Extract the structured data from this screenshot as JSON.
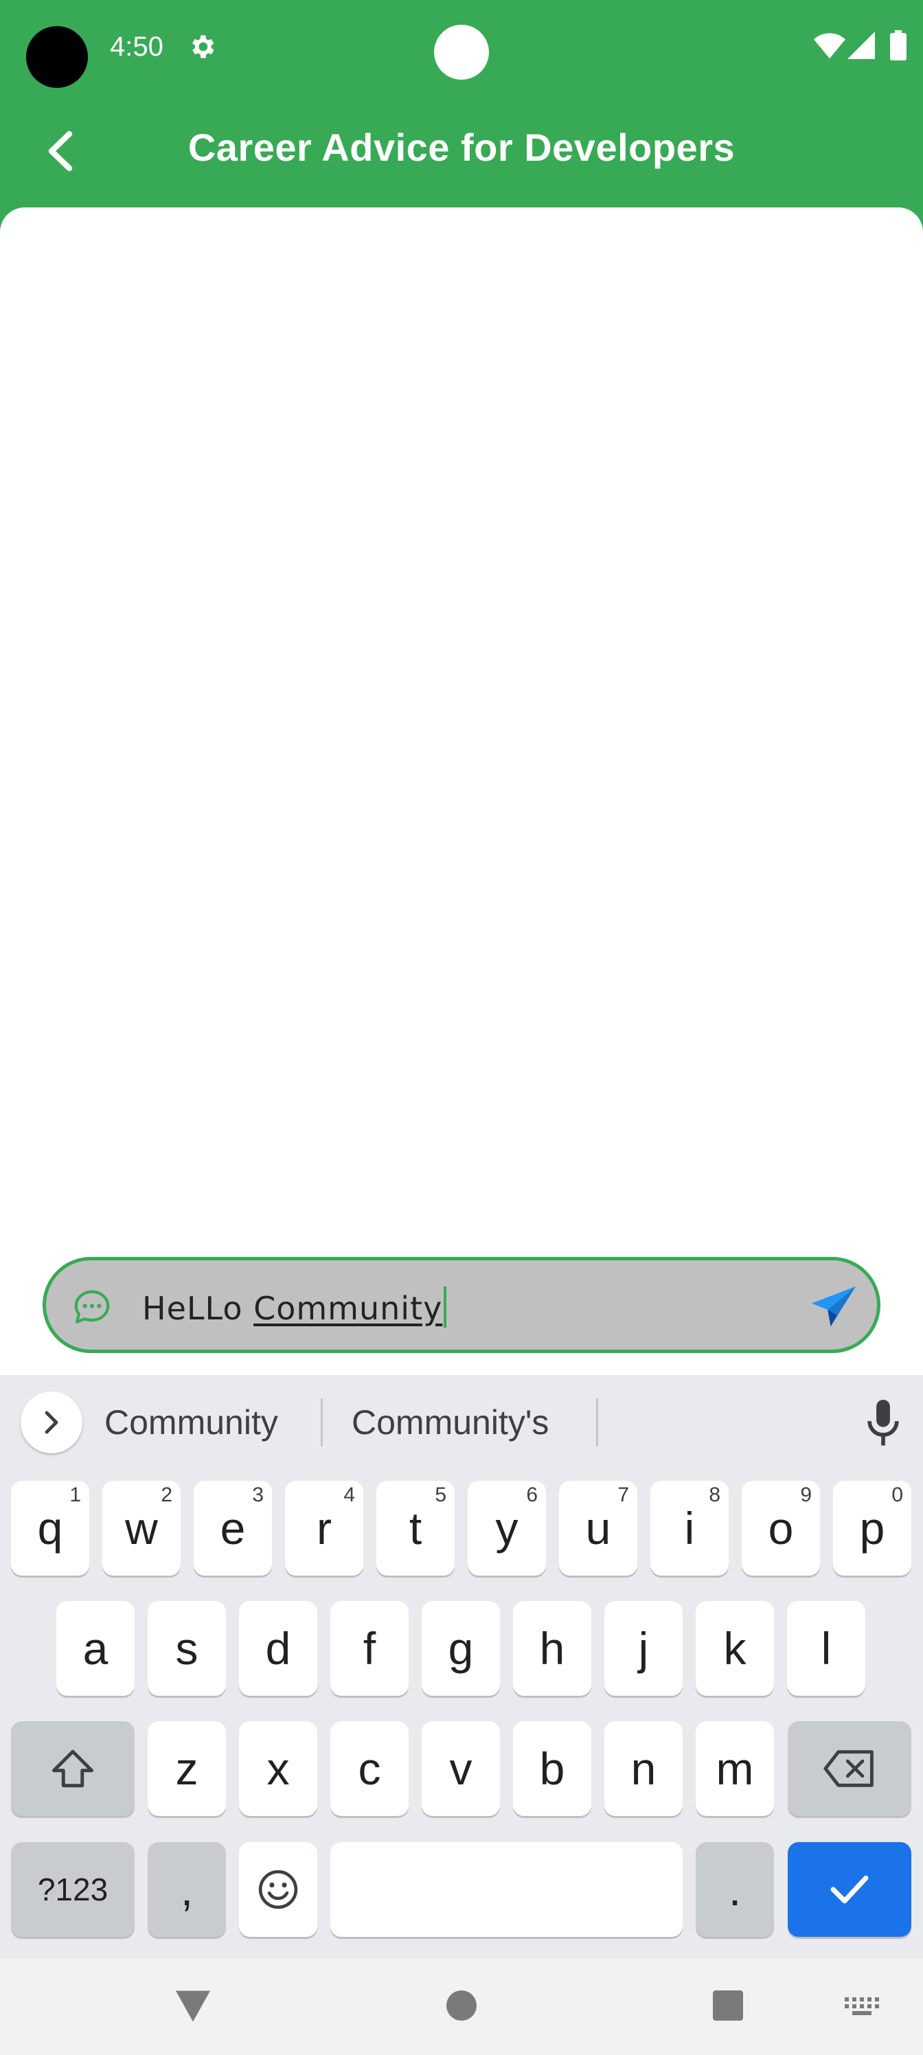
{
  "status_bar": {
    "time": "4:50",
    "icons": [
      "gear-icon",
      "wifi-icon",
      "signal-icon",
      "battery-icon"
    ]
  },
  "app_bar": {
    "back_icon": "chevron-left-icon",
    "title": "Career Advice for Developers"
  },
  "composer": {
    "icon": "chat-bubble-icon",
    "text_committed": "HeLLo ",
    "text_composing": "Community",
    "send_icon": "send-icon"
  },
  "keyboard": {
    "suggestions": [
      "Community",
      "Community's"
    ],
    "row1": [
      {
        "label": "q",
        "hint": "1"
      },
      {
        "label": "w",
        "hint": "2"
      },
      {
        "label": "e",
        "hint": "3"
      },
      {
        "label": "r",
        "hint": "4"
      },
      {
        "label": "t",
        "hint": "5"
      },
      {
        "label": "y",
        "hint": "6"
      },
      {
        "label": "u",
        "hint": "7"
      },
      {
        "label": "i",
        "hint": "8"
      },
      {
        "label": "o",
        "hint": "9"
      },
      {
        "label": "p",
        "hint": "0"
      }
    ],
    "row2": [
      "a",
      "s",
      "d",
      "f",
      "g",
      "h",
      "j",
      "k",
      "l"
    ],
    "row3": [
      "z",
      "x",
      "c",
      "v",
      "b",
      "n",
      "m"
    ],
    "symbols_label": "?123",
    "comma_label": ",",
    "period_label": "."
  },
  "colors": {
    "brand_green": "#38aa55",
    "keyboard_done": "#1a73e8",
    "send_blue": "#2196f3"
  }
}
